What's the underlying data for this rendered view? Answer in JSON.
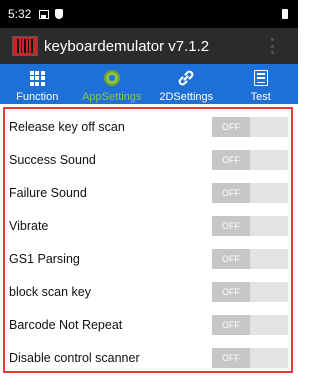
{
  "status_bar": {
    "time": "5:32",
    "icons": [
      "image-icon",
      "shield-icon",
      "battery-icon"
    ]
  },
  "app_bar": {
    "title": "keyboardemulator v7.1.2",
    "logo_icon": "barcode-icon",
    "menu_icon": "overflow-menu-icon"
  },
  "tabs": [
    {
      "label": "Function",
      "icon": "grid-icon",
      "active": false
    },
    {
      "label": "AppSettings",
      "icon": "settings-icon",
      "active": true
    },
    {
      "label": "2DSettings",
      "icon": "link-icon",
      "active": false
    },
    {
      "label": "Test",
      "icon": "list-icon",
      "active": false
    }
  ],
  "settings": [
    {
      "label": "Release key off scan",
      "state": "OFF"
    },
    {
      "label": "Success Sound",
      "state": "OFF"
    },
    {
      "label": "Failure Sound",
      "state": "OFF"
    },
    {
      "label": "Vibrate",
      "state": "OFF"
    },
    {
      "label": "GS1 Parsing",
      "state": "OFF"
    },
    {
      "label": "block scan key",
      "state": "OFF"
    },
    {
      "label": "Barcode Not Repeat",
      "state": "OFF"
    },
    {
      "label": "Disable control scanner",
      "state": "OFF"
    }
  ],
  "colors": {
    "status_bar": "#000000",
    "app_bar": "#2b2b2b",
    "tab_bar": "#1e6fd6",
    "active_tab": "#8bc34a",
    "highlight_border": "#e53935",
    "toggle_off": "#c6c6c6"
  }
}
